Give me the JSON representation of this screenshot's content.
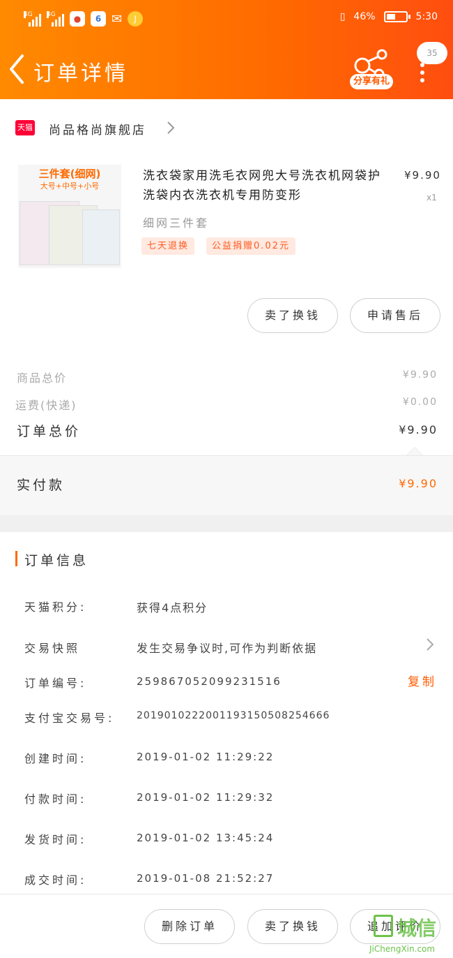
{
  "status_bar": {
    "battery": "46%",
    "time": "5:30",
    "network_1": "4G",
    "network_2": "4G"
  },
  "header": {
    "title": "订单详情",
    "share_label": "分享有礼",
    "message_count": "35"
  },
  "store": {
    "badge": "天猫",
    "name": "尚品格尚旗舰店"
  },
  "product": {
    "thumb_line1": "三件套(细网)",
    "thumb_line2": "大号+中号+小号",
    "title": "洗衣袋家用洗毛衣网兜大号洗衣机网袋护洗袋内衣洗衣机专用防变形",
    "price": "¥9.90",
    "quantity": "x1",
    "sku": "细网三件套",
    "tags": [
      "七天退换",
      "公益捐赠0.02元"
    ],
    "actions": [
      "卖了换钱",
      "申请售后"
    ]
  },
  "summary": {
    "goods_label": "商品总价",
    "goods_value": "¥9.90",
    "shipping_label": "运费(快递)",
    "shipping_value": "¥0.00",
    "total_label": "订单总价",
    "total_value": "¥9.90",
    "paid_label": "实付款",
    "paid_value": "¥9.90"
  },
  "order_info": {
    "section_title": "订单信息",
    "rows": [
      {
        "label": "天猫积分:",
        "value": "获得4点积分"
      },
      {
        "label": "交易快照",
        "value": "发生交易争议时,可作为判断依据"
      },
      {
        "label": "订单编号:",
        "value": "259867052099231516"
      },
      {
        "label": "支付宝交易号:",
        "value": "2019010222001193150508254666"
      },
      {
        "label": "创建时间:",
        "value": "2019-01-02 11:29:22"
      },
      {
        "label": "付款时间:",
        "value": "2019-01-02 11:29:32"
      },
      {
        "label": "发货时间:",
        "value": "2019-01-02 13:45:24"
      },
      {
        "label": "成交时间:",
        "value": "2019-01-08 21:52:27"
      }
    ],
    "copy_label": "复制"
  },
  "bottom_bar": {
    "buttons": [
      "删除订单",
      "卖了换钱",
      "追加评价"
    ]
  },
  "watermark": {
    "text": "城信",
    "url": "JiChengXin.com"
  },
  "colors": {
    "accent": "#ff6a00",
    "header_start": "#ff8a00",
    "header_end": "#ff4e10",
    "tmall_red": "#ff0036"
  }
}
